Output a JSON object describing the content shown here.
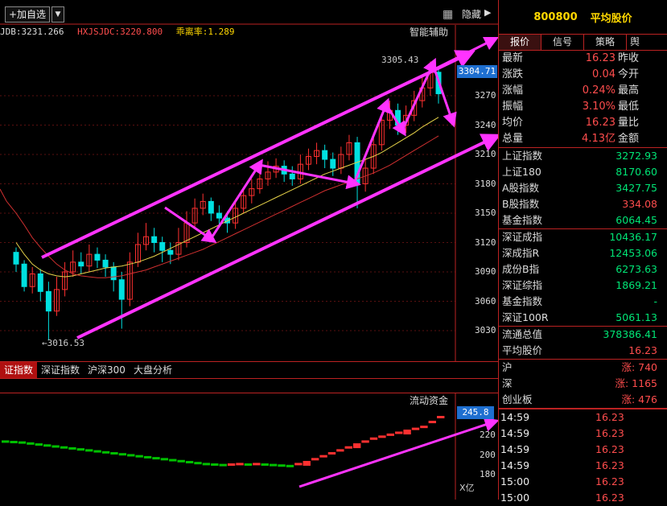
{
  "toolbar": {
    "add_label": "+加自选",
    "dropdown": "▼",
    "hide_label": "隐藏",
    "hide_arrow": "▶"
  },
  "indicators": {
    "jdb": "JDB:3231.266",
    "hxjsjdc": "HXJSJDC:3220.800",
    "ratio": "乖离率:1.289"
  },
  "chart_title": "智能辅助",
  "price_labels": {
    "high": "3305.43",
    "low": "3016.53",
    "current": "3304.71"
  },
  "price_axis": [
    "3270",
    "3240",
    "3210",
    "3180",
    "3150",
    "3120",
    "3090",
    "3060",
    "3030"
  ],
  "index_tabs": [
    "证指数",
    "深证指数",
    "沪深300",
    "大盘分析"
  ],
  "flow": {
    "title": "流动资金",
    "current": "245.8",
    "axis": [
      "220",
      "200",
      "180"
    ],
    "unit": "X亿"
  },
  "colors": {
    "up": "#ff3030",
    "down": "#00e0e0",
    "arrow": "#ff33ff",
    "accent": "#b01010"
  },
  "chart_data": {
    "type": "candlestick",
    "ylim": [
      3016.53,
      3305.43
    ],
    "candles": [
      [
        3110,
        3098,
        3115,
        3090
      ],
      [
        3098,
        3075,
        3102,
        3070
      ],
      [
        3075,
        3088,
        3095,
        3068
      ],
      [
        3088,
        3070,
        3093,
        3060
      ],
      [
        3070,
        3050,
        3080,
        3020
      ],
      [
        3050,
        3072,
        3085,
        3045
      ],
      [
        3072,
        3090,
        3100,
        3065
      ],
      [
        3090,
        3100,
        3112,
        3085
      ],
      [
        3100,
        3096,
        3110,
        3088
      ],
      [
        3096,
        3108,
        3118,
        3090
      ],
      [
        3108,
        3102,
        3115,
        3094
      ],
      [
        3102,
        3095,
        3108,
        3085
      ],
      [
        3095,
        3082,
        3100,
        3070
      ],
      [
        3082,
        3062,
        3090,
        3032
      ],
      [
        3062,
        3100,
        3110,
        3055
      ],
      [
        3100,
        3118,
        3130,
        3095
      ],
      [
        3118,
        3126,
        3140,
        3112
      ],
      [
        3126,
        3120,
        3135,
        3110
      ],
      [
        3120,
        3112,
        3126,
        3100
      ],
      [
        3112,
        3108,
        3120,
        3098
      ],
      [
        3108,
        3120,
        3135,
        3102
      ],
      [
        3120,
        3140,
        3152,
        3115
      ],
      [
        3140,
        3155,
        3165,
        3135
      ],
      [
        3155,
        3162,
        3170,
        3148
      ],
      [
        3162,
        3150,
        3166,
        3142
      ],
      [
        3150,
        3145,
        3158,
        3138
      ],
      [
        3145,
        3140,
        3152,
        3130
      ],
      [
        3140,
        3155,
        3162,
        3134
      ],
      [
        3155,
        3168,
        3175,
        3150
      ],
      [
        3168,
        3175,
        3185,
        3160
      ],
      [
        3175,
        3185,
        3196,
        3170
      ],
      [
        3185,
        3192,
        3203,
        3178
      ],
      [
        3192,
        3198,
        3206,
        3186
      ],
      [
        3198,
        3190,
        3204,
        3182
      ],
      [
        3190,
        3185,
        3198,
        3178
      ],
      [
        3185,
        3200,
        3210,
        3180
      ],
      [
        3200,
        3208,
        3216,
        3194
      ],
      [
        3208,
        3214,
        3222,
        3200
      ],
      [
        3214,
        3205,
        3220,
        3196
      ],
      [
        3205,
        3196,
        3212,
        3188
      ],
      [
        3196,
        3210,
        3218,
        3190
      ],
      [
        3210,
        3222,
        3230,
        3204
      ],
      [
        3222,
        3180,
        3228,
        3155
      ],
      [
        3180,
        3196,
        3205,
        3172
      ],
      [
        3196,
        3220,
        3232,
        3190
      ],
      [
        3220,
        3245,
        3252,
        3214
      ],
      [
        3245,
        3255,
        3265,
        3236
      ],
      [
        3255,
        3240,
        3262,
        3230
      ],
      [
        3240,
        3250,
        3260,
        3232
      ],
      [
        3250,
        3265,
        3275,
        3244
      ],
      [
        3265,
        3278,
        3290,
        3258
      ],
      [
        3278,
        3294,
        3305,
        3270
      ],
      [
        3294,
        3272,
        3300,
        3262
      ]
    ],
    "ma_yellow": [
      3120,
      3108,
      3098,
      3092,
      3088,
      3086,
      3085,
      3086,
      3088,
      3090,
      3092,
      3094,
      3095,
      3096,
      3098,
      3100,
      3103,
      3106,
      3110,
      3114,
      3118,
      3122,
      3126,
      3130,
      3134,
      3138,
      3142,
      3146,
      3150,
      3154,
      3158,
      3162,
      3166,
      3170,
      3174,
      3178,
      3182,
      3186,
      3190,
      3193,
      3196,
      3199,
      3202,
      3205,
      3208,
      3212,
      3217,
      3222,
      3227,
      3232,
      3238,
      3243,
      3248
    ],
    "ma_red": [
      3150,
      3138,
      3125,
      3115,
      3106,
      3098,
      3092,
      3088,
      3086,
      3085,
      3084,
      3084,
      3085,
      3086,
      3088,
      3090,
      3092,
      3095,
      3098,
      3101,
      3104,
      3107,
      3110,
      3113,
      3117,
      3121,
      3125,
      3129,
      3133,
      3137,
      3141,
      3145,
      3149,
      3153,
      3157,
      3161,
      3165,
      3169,
      3173,
      3176,
      3179,
      3182,
      3185,
      3188,
      3191,
      3195,
      3199,
      3204,
      3209,
      3214,
      3219,
      3224,
      3229
    ],
    "flow": [
      {
        "level": 215,
        "dir": "down"
      },
      {
        "level": 214.5,
        "dir": "down"
      },
      {
        "level": 214,
        "dir": "down"
      },
      {
        "level": 213,
        "dir": "down"
      },
      {
        "level": 212,
        "dir": "down"
      },
      {
        "level": 211,
        "dir": "down"
      },
      {
        "level": 210,
        "dir": "down"
      },
      {
        "level": 209,
        "dir": "down"
      },
      {
        "level": 208,
        "dir": "down"
      },
      {
        "level": 207,
        "dir": "down"
      },
      {
        "level": 206,
        "dir": "down"
      },
      {
        "level": 205,
        "dir": "down"
      },
      {
        "level": 204,
        "dir": "down"
      },
      {
        "level": 203,
        "dir": "down"
      },
      {
        "level": 202,
        "dir": "down"
      },
      {
        "level": 201,
        "dir": "down"
      },
      {
        "level": 200,
        "dir": "down"
      },
      {
        "level": 199,
        "dir": "down"
      },
      {
        "level": 198,
        "dir": "down"
      },
      {
        "level": 197,
        "dir": "down"
      },
      {
        "level": 196,
        "dir": "down"
      },
      {
        "level": 195,
        "dir": "down"
      },
      {
        "level": 194,
        "dir": "down"
      },
      {
        "level": 193,
        "dir": "down"
      },
      {
        "level": 192,
        "dir": "down"
      },
      {
        "level": 191.5,
        "dir": "down"
      },
      {
        "level": 191,
        "dir": "down"
      },
      {
        "level": 191.5,
        "dir": "up"
      },
      {
        "level": 192,
        "dir": "up"
      },
      {
        "level": 191.5,
        "dir": "down"
      },
      {
        "level": 192,
        "dir": "up"
      },
      {
        "level": 191.5,
        "dir": "down"
      },
      {
        "level": 191,
        "dir": "down"
      },
      {
        "level": 190.5,
        "dir": "down"
      },
      {
        "level": 190,
        "dir": "down"
      },
      {
        "level": 192,
        "dir": "up"
      },
      {
        "level": 194,
        "dir": "up"
      },
      {
        "level": 197,
        "dir": "up"
      },
      {
        "level": 200,
        "dir": "up"
      },
      {
        "level": 203,
        "dir": "up"
      },
      {
        "level": 206,
        "dir": "up"
      },
      {
        "level": 209,
        "dir": "up"
      },
      {
        "level": 212,
        "dir": "up"
      },
      {
        "level": 215,
        "dir": "up"
      },
      {
        "level": 218,
        "dir": "up"
      },
      {
        "level": 220,
        "dir": "up"
      },
      {
        "level": 222,
        "dir": "up"
      },
      {
        "level": 224,
        "dir": "up"
      },
      {
        "level": 226,
        "dir": "up"
      },
      {
        "level": 228,
        "dir": "up"
      },
      {
        "level": 230,
        "dir": "up"
      },
      {
        "level": 235,
        "dir": "up"
      },
      {
        "level": 240,
        "dir": "up"
      }
    ]
  },
  "quote": {
    "code": "800800",
    "name": "平均股价",
    "tabs": [
      "报价",
      "信号",
      "策略",
      "舆"
    ],
    "rows": [
      {
        "k": "最新",
        "v": "16.23",
        "k2": "昨收"
      },
      {
        "k": "涨跌",
        "v": "0.04",
        "k2": "今开"
      },
      {
        "k": "涨幅",
        "v": "0.24%",
        "k2": "最高"
      },
      {
        "k": "振幅",
        "v": "3.10%",
        "k2": "最低"
      },
      {
        "k": "均价",
        "v": "16.23",
        "k2": "量比"
      },
      {
        "k": "总量",
        "v": "4.13亿",
        "k2": "金额"
      }
    ]
  },
  "indices": [
    {
      "k": "上证指数",
      "v": "3272.93",
      "c": "dn"
    },
    {
      "k": "上证180",
      "v": "8170.60",
      "c": "dn"
    },
    {
      "k": "A股指数",
      "v": "3427.75",
      "c": "dn"
    },
    {
      "k": "B股指数",
      "v": "334.08",
      "c": "up"
    },
    {
      "k": "基金指数",
      "v": "6064.45",
      "c": "dn"
    }
  ],
  "indices2": [
    {
      "k": "深证成指",
      "v": "10436.17",
      "c": "dn"
    },
    {
      "k": "深成指R",
      "v": "12453.06",
      "c": "dn"
    },
    {
      "k": "成份B指",
      "v": "6273.63",
      "c": "dn"
    },
    {
      "k": "深证综指",
      "v": "1869.21",
      "c": "dn"
    },
    {
      "k": "基金指数",
      "v": "-",
      "c": "dn"
    },
    {
      "k": "深证100R",
      "v": "5061.13",
      "c": "dn"
    }
  ],
  "misc": [
    {
      "k": "流通总值",
      "v": "378386.41",
      "c": "dn"
    },
    {
      "k": "平均股价",
      "v": "16.23",
      "c": "up"
    }
  ],
  "breadth": [
    {
      "k": "沪",
      "v": "涨: 740"
    },
    {
      "k": "深",
      "v": "涨: 1165"
    },
    {
      "k": "创业板",
      "v": "涨: 476"
    }
  ],
  "ticks": [
    {
      "t": "14:59",
      "p": "16.23"
    },
    {
      "t": "14:59",
      "p": "16.23"
    },
    {
      "t": "14:59",
      "p": "16.23"
    },
    {
      "t": "14:59",
      "p": "16.23"
    },
    {
      "t": "15:00",
      "p": "16.23"
    },
    {
      "t": "15:00",
      "p": "16.23"
    }
  ]
}
